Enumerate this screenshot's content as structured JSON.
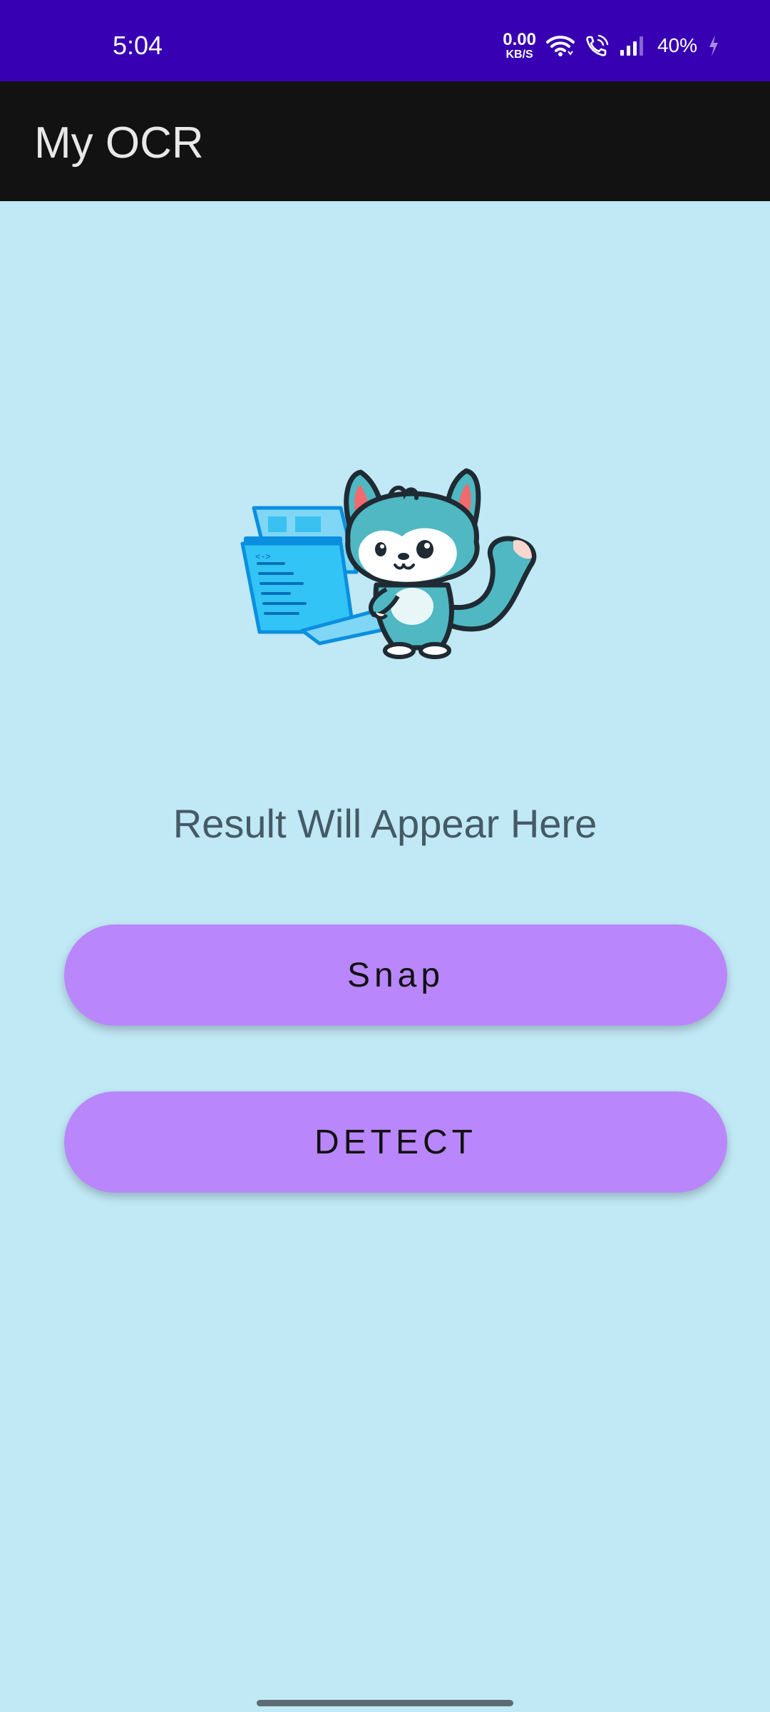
{
  "status_bar": {
    "time": "5:04",
    "net_speed_value": "0.00",
    "net_speed_unit": "KB/S",
    "battery": "40%",
    "icons": [
      "wifi-icon",
      "wifi-calling-icon",
      "signal-icon",
      "battery-charging-icon"
    ],
    "background": "#3700B3"
  },
  "app_bar": {
    "title": "My OCR",
    "background": "#121212"
  },
  "main": {
    "background": "#C0E8F5",
    "illustration": "fox-laptop-illustration",
    "result_text": "Result Will Appear Here",
    "snap_label": "Snap",
    "detect_label": "DETECT",
    "button_color": "#B987FB"
  }
}
